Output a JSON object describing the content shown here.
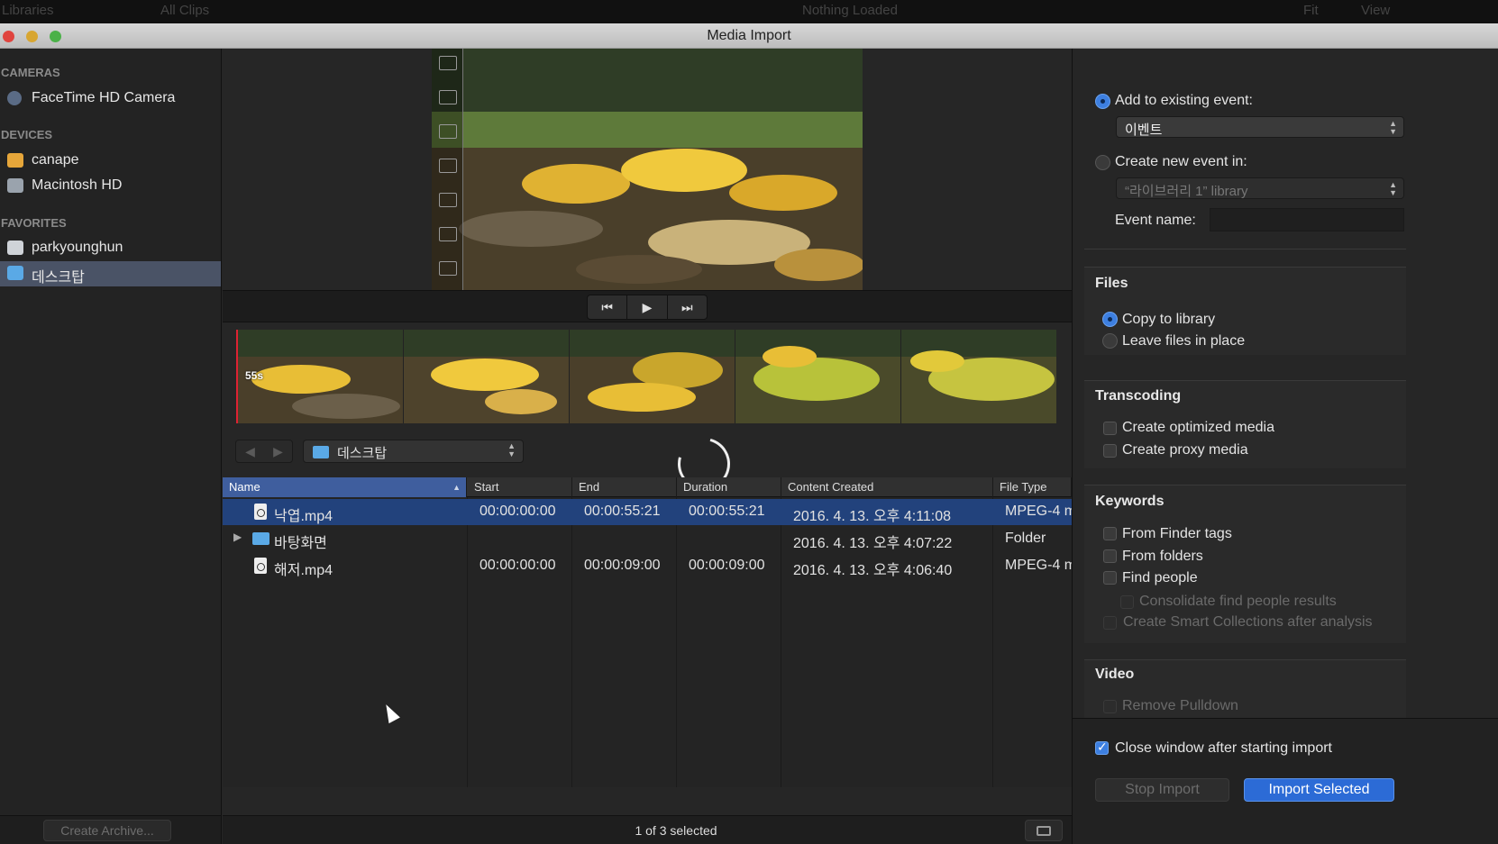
{
  "background_app": {
    "libraries_label": "Libraries",
    "all_clips_label": "All Clips",
    "nothing_loaded_label": "Nothing Loaded",
    "fit_label": "Fit",
    "view_label": "View"
  },
  "window": {
    "title": "Media Import"
  },
  "sidebar": {
    "sections": [
      {
        "title": "CAMERAS",
        "items": [
          {
            "label": "FaceTime HD Camera",
            "icon": "camera-icon"
          }
        ]
      },
      {
        "title": "DEVICES",
        "items": [
          {
            "label": "canape",
            "icon": "external-drive-icon"
          },
          {
            "label": "Macintosh HD",
            "icon": "hard-drive-icon"
          }
        ]
      },
      {
        "title": "FAVORITES",
        "items": [
          {
            "label": "parkyounghun",
            "icon": "home-icon"
          },
          {
            "label": "데스크탑",
            "icon": "desktop-icon",
            "selected": true
          }
        ]
      }
    ],
    "create_archive_label": "Create Archive..."
  },
  "viewer": {
    "duration_badge": "55s",
    "transport": {
      "prev": "⏮",
      "play": "▶",
      "next": "⏭"
    }
  },
  "browser": {
    "folder_popup_label": "데스크탑",
    "columns": [
      "Name",
      "Start",
      "End",
      "Duration",
      "Content Created",
      "File Type"
    ],
    "rows": [
      {
        "name": "낙엽.mp4",
        "kind": "file",
        "start": "00:00:00:00",
        "end": "00:00:55:21",
        "duration": "00:00:55:21",
        "created": "2016. 4. 13. 오후 4:11:08",
        "type": "MPEG-4 m",
        "selected": true
      },
      {
        "name": "바탕화면",
        "kind": "folder",
        "start": "",
        "end": "",
        "duration": "",
        "created": "2016. 4. 13. 오후 4:07:22",
        "type": "Folder"
      },
      {
        "name": "해저.mp4",
        "kind": "file",
        "start": "00:00:00:00",
        "end": "00:00:09:00",
        "duration": "00:00:09:00",
        "created": "2016. 4. 13. 오후 4:06:40",
        "type": "MPEG-4 m"
      }
    ],
    "status_text": "1 of 3 selected"
  },
  "options": {
    "add_to_existing_label": "Add to existing event:",
    "existing_event_value": "이벤트",
    "create_new_label": "Create new event in:",
    "library_value": "“라이브러리 1” library",
    "event_name_label": "Event name:",
    "event_name_value": "",
    "files_title": "Files",
    "copy_to_library_label": "Copy to library",
    "leave_in_place_label": "Leave files in place",
    "transcoding_title": "Transcoding",
    "optimized_label": "Create optimized media",
    "proxy_label": "Create proxy media",
    "keywords_title": "Keywords",
    "finder_tags_label": "From Finder tags",
    "folders_label": "From folders",
    "find_people_label": "Find people",
    "consolidate_label": "Consolidate find people results",
    "smart_collections_label": "Create Smart Collections after analysis",
    "video_title": "Video",
    "remove_pulldown_label": "Remove Pulldown",
    "close_window_label": "Close window after starting import",
    "stop_import_label": "Stop Import",
    "import_selected_label": "Import Selected"
  },
  "colors": {
    "accent": "#2c6bd6",
    "selection": "#22427c",
    "sidebar_selection": "#4a5366"
  }
}
